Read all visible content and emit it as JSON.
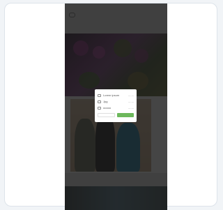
{
  "dialog": {
    "rows": [
      {
        "icon": "document-icon",
        "label": "Lorem ipsum",
        "value": "— —"
      },
      {
        "icon": "image-icon",
        "label": "Jpg",
        "value": "— —"
      },
      {
        "icon": "media-icon",
        "label": "ooooo",
        "value": "— —"
      }
    ],
    "cancel_label": "",
    "ok_label": ""
  },
  "colors": {
    "accent_green": "#6db85c",
    "overlay": "#141414"
  }
}
